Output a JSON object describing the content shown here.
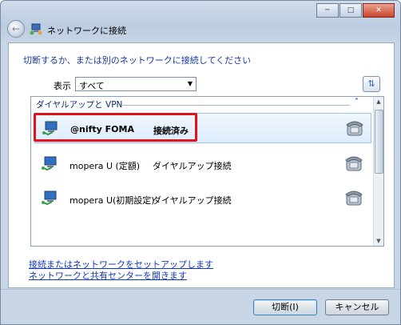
{
  "window": {
    "title": "ネットワークに接続"
  },
  "instruction": "切断するか、または別のネットワークに接続してください",
  "filter": {
    "label": "表示",
    "value": "すべて"
  },
  "list": {
    "group_header": "ダイヤルアップと VPN",
    "items": [
      {
        "name": "@nifty FOMA",
        "status": "接続済み",
        "selected": true
      },
      {
        "name": "mopera U (定額)",
        "status": "ダイヤルアップ接続",
        "selected": false
      },
      {
        "name": "mopera U(初期設定)",
        "status": "ダイヤルアップ接続",
        "selected": false
      }
    ]
  },
  "links": {
    "setup": "接続またはネットワークをセットアップします",
    "center": "ネットワークと共有センターを開きます"
  },
  "buttons": {
    "disconnect": "切断(I)",
    "cancel": "キャンセル"
  },
  "icons": [
    "back-arrow-icon",
    "network-icon",
    "refresh-icon",
    "dialup-connection-icon",
    "phone-icon",
    "minimize-icon",
    "maximize-icon",
    "close-icon"
  ],
  "colors": {
    "highlight": "#e0131a",
    "link": "#1338b8",
    "instruction": "#1a3aa0"
  }
}
